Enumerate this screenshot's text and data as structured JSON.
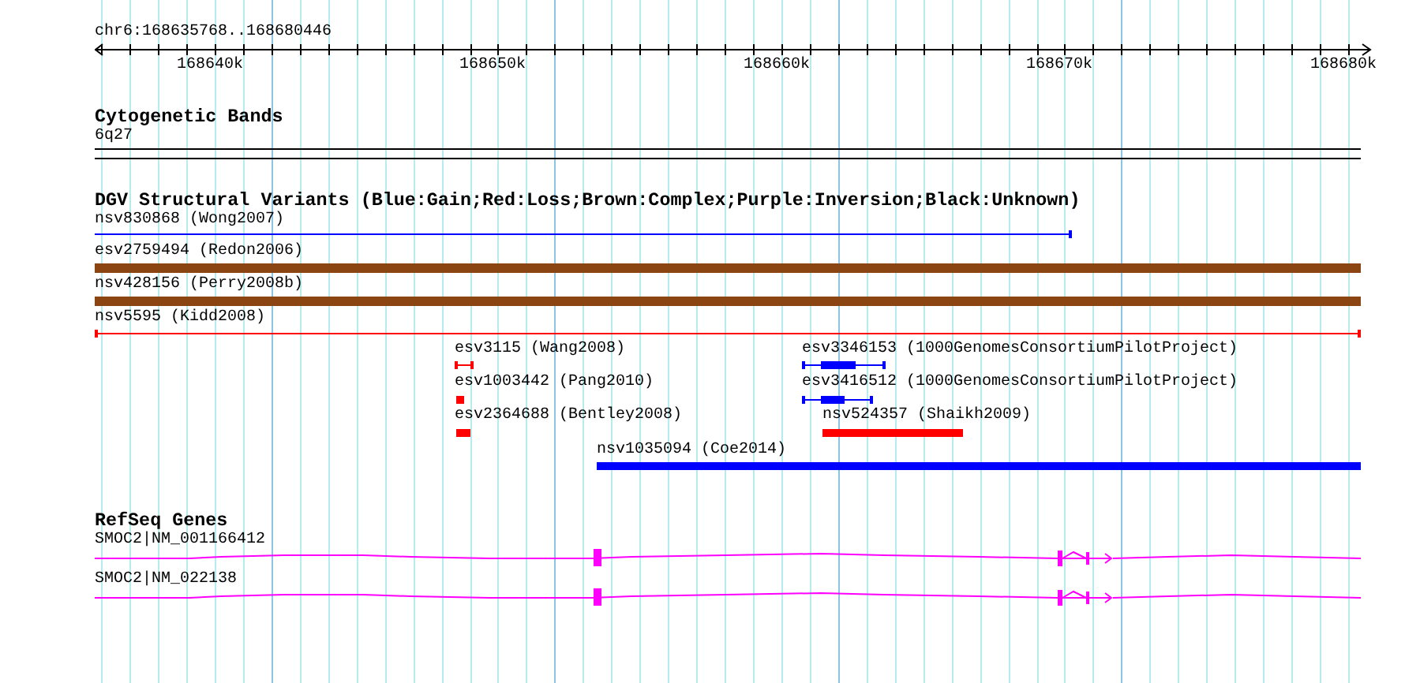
{
  "ruler": {
    "range": "chr6:168635768..168680446",
    "ticks": [
      "168640k",
      "168650k",
      "168660k",
      "168670k",
      "168680k"
    ]
  },
  "tracks": [
    {
      "kind": "bands",
      "title": "Cytogenetic Bands",
      "features": [
        {
          "label": "6q27"
        }
      ]
    },
    {
      "kind": "variants",
      "title": "DGV Structural Variants (Blue:Gain;Red:Loss;Brown:Complex;Purple:Inversion;Black:Unknown)",
      "features": [
        {
          "label": "nsv830868 (Wong2007)",
          "color": "#0000ff",
          "kind": "line"
        },
        {
          "label": "esv2759494 (Redon2006)",
          "color": "#8b4513",
          "kind": "bar"
        },
        {
          "label": "nsv428156 (Perry2008b)",
          "color": "#8b4513",
          "kind": "bar"
        },
        {
          "label": "nsv5595 (Kidd2008)",
          "color": "#ff0000",
          "kind": "line"
        },
        {
          "label": "esv3115 (Wang2008)",
          "color": "#ff0000",
          "kind": "line"
        },
        {
          "label": "esv3346153 (1000GenomesConsortiumPilotProject)",
          "color": "#0000ff",
          "kind": "paired"
        },
        {
          "label": "esv1003442 (Pang2010)",
          "color": "#ff0000",
          "kind": "bar"
        },
        {
          "label": "esv3416512 (1000GenomesConsortiumPilotProject)",
          "color": "#0000ff",
          "kind": "paired"
        },
        {
          "label": "esv2364688 (Bentley2008)",
          "color": "#ff0000",
          "kind": "bar"
        },
        {
          "label": "nsv524357 (Shaikh2009)",
          "color": "#ff0000",
          "kind": "bar"
        },
        {
          "label": "nsv1035094 (Coe2014)",
          "color": "#0000ff",
          "kind": "bar"
        }
      ]
    },
    {
      "kind": "genes",
      "title": "RefSeq Genes",
      "features": [
        {
          "label": "SMOC2|NM_001166412"
        },
        {
          "label": "SMOC2|NM_022138"
        }
      ]
    }
  ]
}
